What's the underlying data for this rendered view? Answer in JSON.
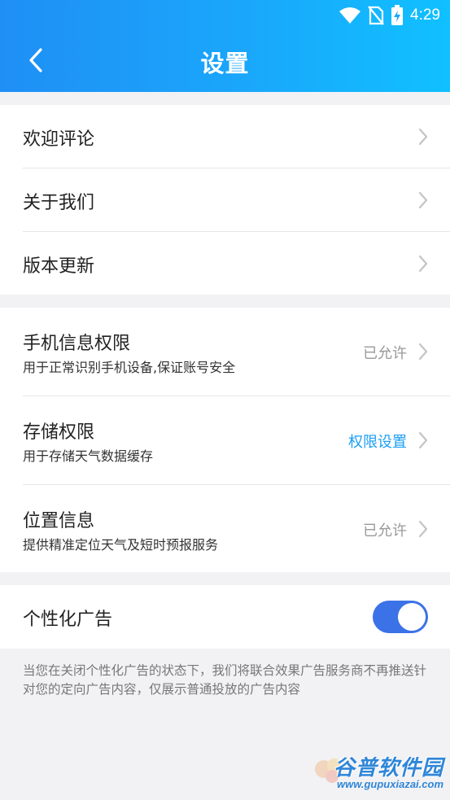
{
  "status_bar": {
    "time": "4:29"
  },
  "header": {
    "title": "设置"
  },
  "group1": {
    "items": [
      {
        "label": "欢迎评论"
      },
      {
        "label": "关于我们"
      },
      {
        "label": "版本更新"
      }
    ]
  },
  "group2": {
    "items": [
      {
        "label": "手机信息权限",
        "desc": "用于正常识别手机设备,保证账号安全",
        "value": "已允许"
      },
      {
        "label": "存储权限",
        "desc": "用于存储天气数据缓存",
        "value": "权限设置"
      },
      {
        "label": "位置信息",
        "desc": "提供精准定位天气及短时预报服务",
        "value": "已允许"
      }
    ]
  },
  "ads": {
    "label": "个性化广告",
    "enabled": true
  },
  "note": "当您在关闭个性化广告的状态下，我们将联合效果广告服务商不再推送针对您的定向广告内容，仅展示普通投放的广告内容",
  "watermark": {
    "name": "谷普软件园",
    "url": "www.gupuxiazai.com"
  },
  "colors": {
    "header_start": "#1f8ff5",
    "header_end": "#10c0ff",
    "accent": "#1a9ef5",
    "toggle_on": "#3c72e8"
  }
}
